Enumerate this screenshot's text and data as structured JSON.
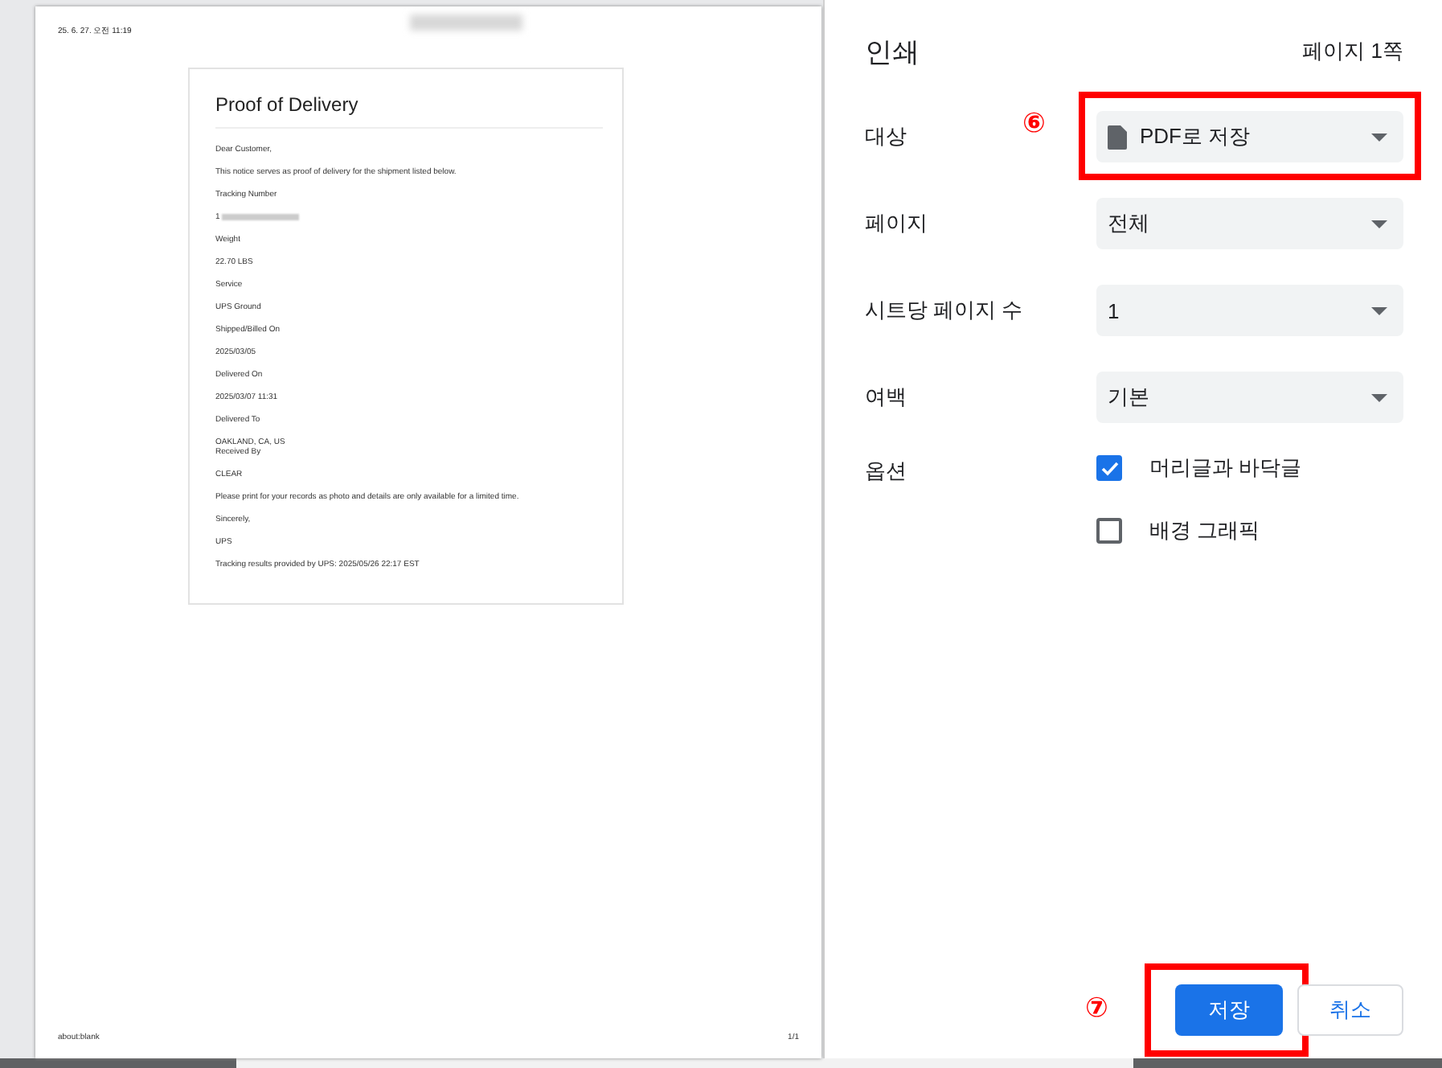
{
  "preview": {
    "header_date": "25. 6. 27. 오전 11:19",
    "header_title_redacted": true,
    "title": "Proof of Delivery",
    "lines": [
      {
        "kind": "text",
        "text": "Dear Customer,"
      },
      {
        "kind": "text",
        "text": "This notice serves as proof of delivery for the shipment listed below."
      },
      {
        "kind": "text",
        "text": "Tracking Number"
      },
      {
        "kind": "redacted",
        "text": "1"
      },
      {
        "kind": "text",
        "text": "Weight"
      },
      {
        "kind": "text",
        "text": "22.70 LBS"
      },
      {
        "kind": "text",
        "text": "Service"
      },
      {
        "kind": "text",
        "text": "UPS Ground"
      },
      {
        "kind": "text",
        "text": "Shipped/Billed On"
      },
      {
        "kind": "text",
        "text": "2025/03/05"
      },
      {
        "kind": "text",
        "text": "Delivered On"
      },
      {
        "kind": "text",
        "text": "2025/03/07 11:31"
      },
      {
        "kind": "text",
        "text": "Delivered To"
      },
      {
        "kind": "text",
        "text": "OAKLAND, CA, US"
      },
      {
        "kind": "continuation",
        "text": "Received By"
      },
      {
        "kind": "text",
        "text": "CLEAR"
      },
      {
        "kind": "text",
        "text": "Please print for your records as photo and details are only available for a limited time."
      },
      {
        "kind": "text",
        "text": "Sincerely,"
      },
      {
        "kind": "text",
        "text": "UPS"
      },
      {
        "kind": "text",
        "text": "Tracking results provided by UPS: 2025/05/26 22:17 EST"
      }
    ],
    "footer_left": "about:blank",
    "footer_right": "1/1"
  },
  "settings": {
    "title": "인쇄",
    "page_count": "페이지 1쪽",
    "rows": [
      {
        "label": "대상",
        "value": "PDF로 저장",
        "kind": "file-select",
        "annotation": "⑥"
      },
      {
        "label": "페이지",
        "value": "전체",
        "kind": "select"
      },
      {
        "label": "시트당 페이지 수",
        "value": "1",
        "kind": "select"
      },
      {
        "label": "여백",
        "value": "기본",
        "kind": "select"
      }
    ],
    "options_label": "옵션",
    "options": [
      {
        "label": "머리글과 바닥글",
        "checked": true
      },
      {
        "label": "배경 그래픽",
        "checked": false
      }
    ],
    "buttons": [
      {
        "label": "저장",
        "kind": "primary",
        "annotation": "⑦"
      },
      {
        "label": "취소",
        "kind": "secondary"
      }
    ]
  }
}
